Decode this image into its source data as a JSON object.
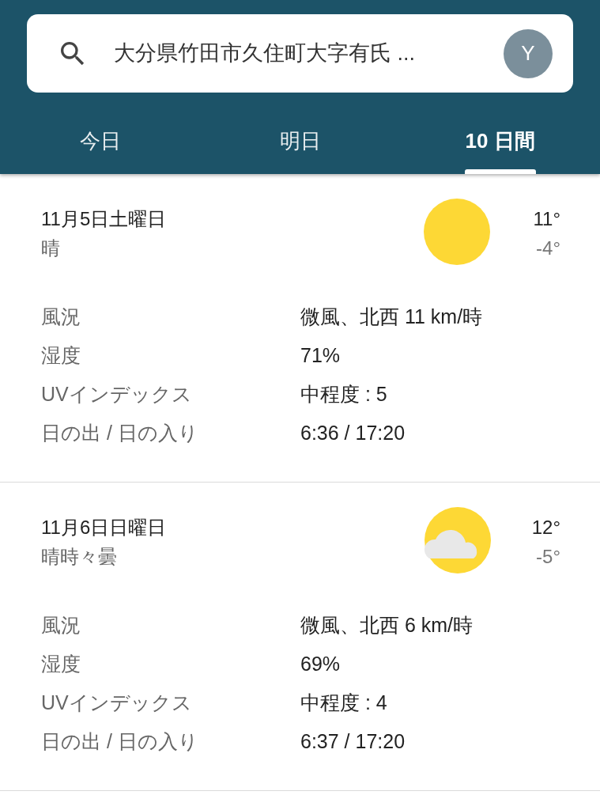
{
  "search": {
    "value": "大分県竹田市久住町大字有氏 ...",
    "avatar": "Y"
  },
  "tabs": [
    {
      "label": "今日",
      "selected": false
    },
    {
      "label": "明日",
      "selected": false
    },
    {
      "label": "10 日間",
      "selected": true
    }
  ],
  "days": [
    {
      "date": "11月5日土曜日",
      "condition": "晴",
      "kind": "sunny",
      "high": "11°",
      "low": "-4°",
      "details": [
        {
          "label": "風況",
          "value": "微風、北西 11 km/時"
        },
        {
          "label": "湿度",
          "value": "71%"
        },
        {
          "label": "UVインデックス",
          "value": "中程度 : 5"
        },
        {
          "label": "日の出 / 日の入り",
          "value": "6:36 / 17:20"
        }
      ]
    },
    {
      "date": "11月6日日曜日",
      "condition": "晴時々曇",
      "kind": "partly_cloudy",
      "high": "12°",
      "low": "-5°",
      "details": [
        {
          "label": "風況",
          "value": "微風、北西 6 km/時"
        },
        {
          "label": "湿度",
          "value": "69%"
        },
        {
          "label": "UVインデックス",
          "value": "中程度 : 4"
        },
        {
          "label": "日の出 / 日の入り",
          "value": "6:37 / 17:20"
        }
      ]
    }
  ]
}
